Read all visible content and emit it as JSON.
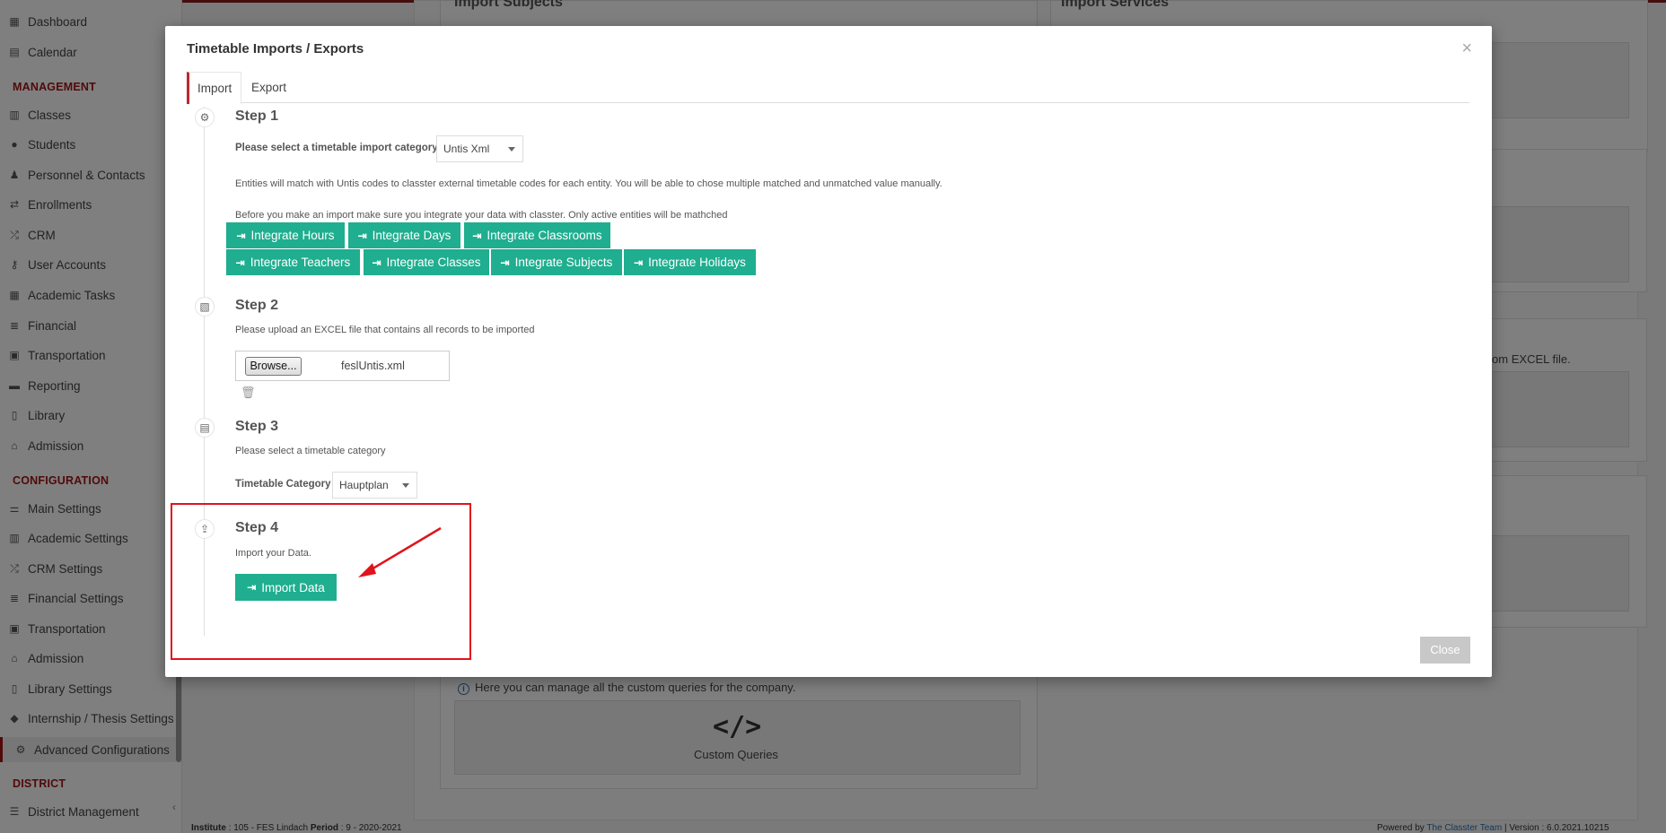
{
  "sidebar": {
    "items_top": [
      {
        "label": "Dashboard",
        "icon": "dashboard-icon"
      },
      {
        "label": "Calendar",
        "icon": "calendar-icon"
      }
    ],
    "management_heading": "MANAGEMENT",
    "management_items": [
      {
        "label": "Classes",
        "icon": "classes-icon"
      },
      {
        "label": "Students",
        "icon": "students-icon"
      },
      {
        "label": "Personnel & Contacts",
        "icon": "personnel-icon"
      },
      {
        "label": "Enrollments",
        "icon": "enrollments-icon"
      },
      {
        "label": "CRM",
        "icon": "crm-icon"
      },
      {
        "label": "User Accounts",
        "icon": "key-icon"
      },
      {
        "label": "Academic Tasks",
        "icon": "tasks-icon"
      },
      {
        "label": "Financial",
        "icon": "financial-icon"
      },
      {
        "label": "Transportation",
        "icon": "bus-icon"
      },
      {
        "label": "Reporting",
        "icon": "printer-icon"
      },
      {
        "label": "Library",
        "icon": "library-icon"
      },
      {
        "label": "Admission",
        "icon": "institution-icon"
      }
    ],
    "configuration_heading": "CONFIGURATION",
    "configuration_items": [
      {
        "label": "Main Settings",
        "icon": "sliders-icon"
      },
      {
        "label": "Academic Settings",
        "icon": "classes-icon"
      },
      {
        "label": "CRM Settings",
        "icon": "crm-icon"
      },
      {
        "label": "Financial Settings",
        "icon": "financial-icon"
      },
      {
        "label": "Transportation",
        "icon": "bus-icon"
      },
      {
        "label": "Admission",
        "icon": "institution-icon"
      },
      {
        "label": "Library Settings",
        "icon": "library-icon"
      },
      {
        "label": "Internship / Thesis Settings",
        "icon": "cube-icon"
      },
      {
        "label": "Advanced Configurations",
        "icon": "gears-icon"
      }
    ],
    "district_heading": "DISTRICT",
    "district_items": [
      {
        "label": "District Management",
        "icon": "list-icon"
      }
    ]
  },
  "background": {
    "import_subjects_title": "Import Subjects",
    "import_services_title": "Import Services",
    "excel_fragment": "s from EXCEL file.",
    "custom_queries_info": "Here you can manage all the custom queries for the company.",
    "custom_queries_icon": "</>",
    "custom_queries_label": "Custom Queries"
  },
  "footer": {
    "institute_label": "Institute",
    "institute_value": ": 105 - FES Lindach",
    "period_label": "Period",
    "period_value": ": 9 - 2020-2021",
    "powered_by": "Powered by",
    "team": "The Classter Team",
    "version": "| Version : 6.0.2021.10215"
  },
  "modal": {
    "title": "Timetable Imports / Exports",
    "close_x": "×",
    "tabs": [
      {
        "label": "Import"
      },
      {
        "label": "Export"
      }
    ],
    "step1": {
      "title": "Step 1",
      "category_label": "Please select a timetable import category",
      "category_value": "Untis Xml",
      "info1": "Entities will match with Untis codes to classter external timetable codes for each entity. You will be able to chose multiple matched and unmatched value manually.",
      "info2": "Before you make an import make sure you integrate your data with classter. Only active entities will be mathched",
      "buttons": [
        "Integrate Hours",
        "Integrate Days",
        "Integrate Classrooms",
        "Integrate Teachers",
        "Integrate Classes",
        "Integrate Subjects",
        "Integrate Holidays"
      ]
    },
    "step2": {
      "title": "Step 2",
      "text": "Please upload an EXCEL file that contains all records to be imported",
      "browse": "Browse...",
      "file_name": "feslUntis.xml"
    },
    "step3": {
      "title": "Step 3",
      "text": "Please select a timetable category",
      "category_label": "Timetable Category",
      "category_value": "Hauptplan"
    },
    "step4": {
      "title": "Step 4",
      "text": "Import your Data.",
      "button": "Import Data"
    },
    "close_button": "Close"
  },
  "colors": {
    "accent_green": "#1fae8f",
    "brand_red": "#a31515",
    "annotation_red": "#e0141b"
  }
}
